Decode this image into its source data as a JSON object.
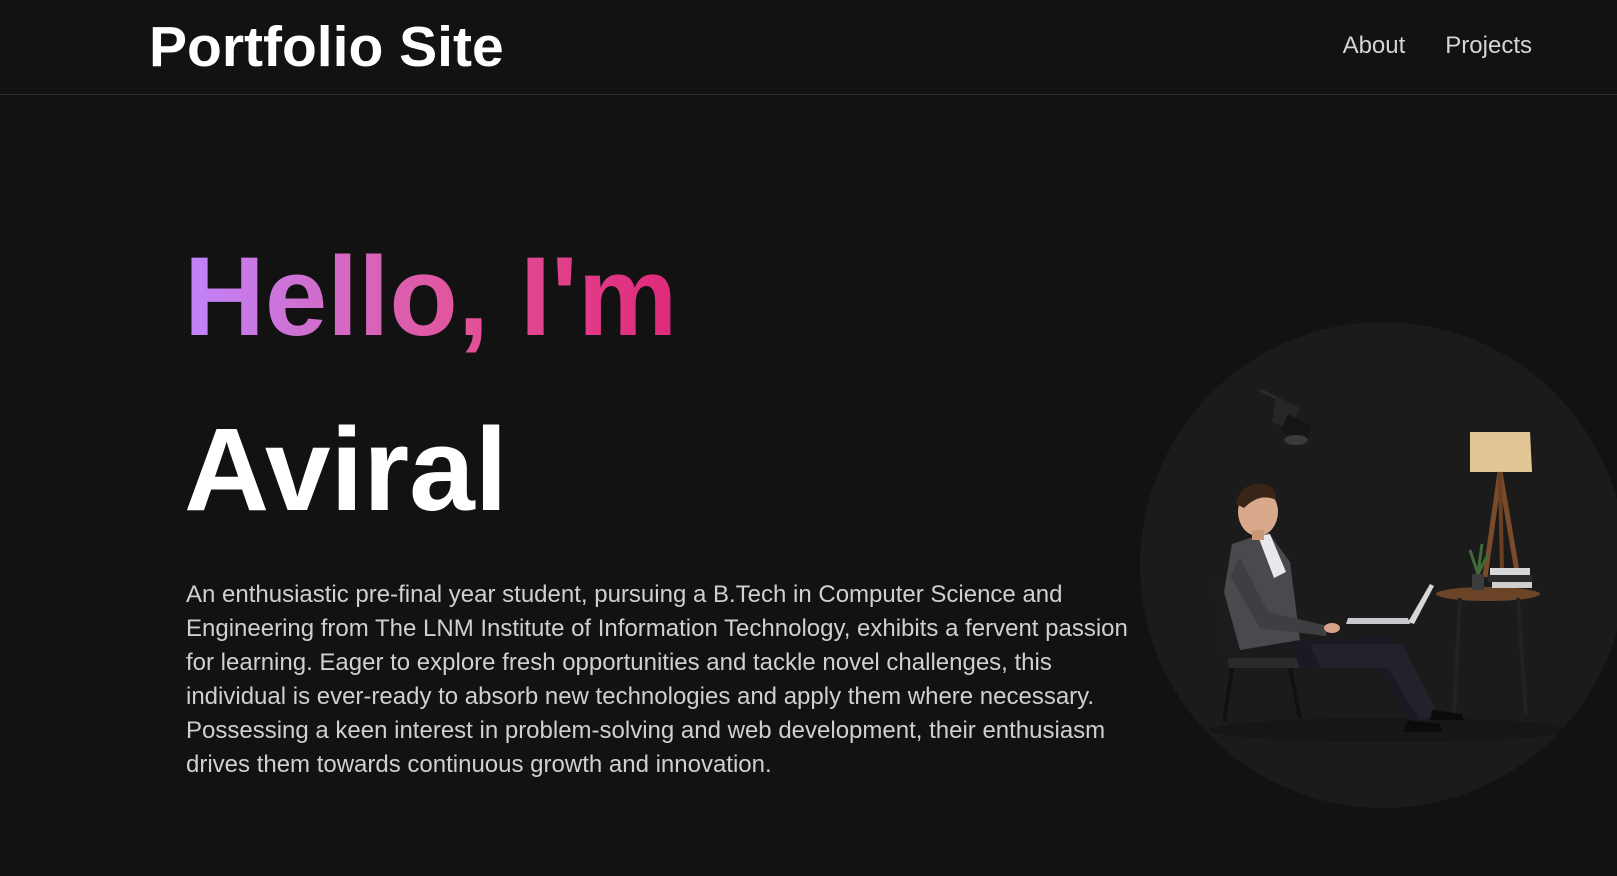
{
  "navbar": {
    "brand": "Portfolio Site",
    "links": [
      {
        "label": "About"
      },
      {
        "label": "Projects"
      }
    ]
  },
  "hero": {
    "greeting": "Hello, I'm",
    "name": "Aviral",
    "bio": "An enthusiastic pre-final year student, pursuing a B.Tech in Computer Science and Engineering from The LNM Institute of Information Technology, exhibits a fervent passion for learning. Eager to explore fresh opportunities and tackle novel challenges, this individual is ever-ready to absorb new technologies and apply them where necessary. Possessing a keen interest in problem-solving and web development, their enthusiasm drives them towards continuous growth and innovation.",
    "illustration_icon": "person-working-on-laptop-illustration"
  },
  "colors": {
    "background": "#121212",
    "gradient_start": "#c084fc",
    "gradient_end": "#e0287a",
    "nav_text": "#d4d4d8",
    "body_text": "#cfcfd4"
  }
}
